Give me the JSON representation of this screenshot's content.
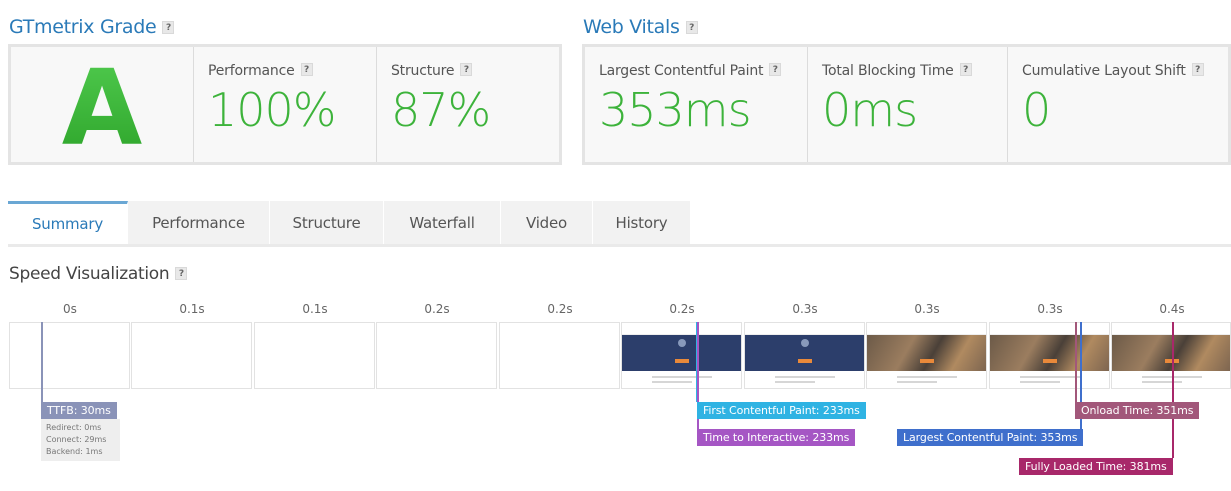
{
  "grade": {
    "title": "GTmetrix Grade",
    "letter": "A",
    "performance_label": "Performance",
    "performance_value": "100%",
    "structure_label": "Structure",
    "structure_value": "87%"
  },
  "vitals": {
    "title": "Web Vitals",
    "lcp_label": "Largest Contentful Paint",
    "lcp_value": "353ms",
    "tbt_label": "Total Blocking Time",
    "tbt_value": "0ms",
    "cls_label": "Cumulative Layout Shift",
    "cls_value": "0"
  },
  "help_glyph": "?",
  "tabs": [
    "Summary",
    "Performance",
    "Structure",
    "Waterfall",
    "Video",
    "History"
  ],
  "speed": {
    "title": "Speed Visualization",
    "time_labels": [
      "0s",
      "0.1s",
      "0.1s",
      "0.2s",
      "0.2s",
      "0.2s",
      "0.3s",
      "0.3s",
      "0.3s",
      "0.4s"
    ],
    "ttfb": {
      "label": "TTFB: 30ms",
      "redirect": "Redirect: 0ms",
      "connect": "Connect: 29ms",
      "backend": "Backend: 1ms"
    },
    "fcp": "First Contentful Paint: 233ms",
    "tti": "Time to Interactive: 233ms",
    "lcp": "Largest Contentful Paint: 353ms",
    "onload": "Onload Time: 351ms",
    "fully_loaded": "Fully Loaded Time: 381ms"
  },
  "colors": {
    "accent": "#2a7ab8",
    "grade_green": "#3db33b",
    "ttfb": "#8a93b8",
    "fcp": "#2fb3e3",
    "tti": "#a556c4",
    "lcp": "#3f6fcc",
    "onload": "#a2577a",
    "fully_loaded": "#a8286a"
  }
}
